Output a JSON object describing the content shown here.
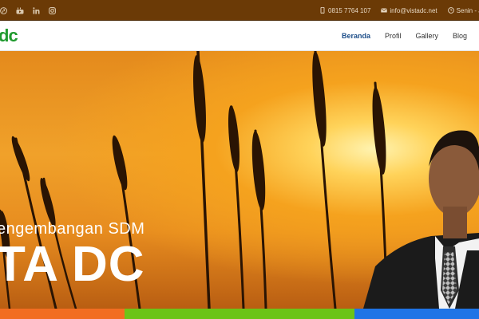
{
  "topbar": {
    "social_icons": [
      "pinterest-icon",
      "youtube-icon",
      "linkedin-icon",
      "instagram-icon"
    ],
    "phone": "0815 7764 107",
    "email": "info@vistadc.net",
    "hours": "Senin - Jus"
  },
  "navbar": {
    "logo": "dc",
    "menu": [
      "Beranda",
      "Profil",
      "Gallery",
      "Blog"
    ],
    "active_index": 0
  },
  "hero": {
    "subtitle": "engembangan SDM",
    "title": "TA DC"
  },
  "colors": {
    "topbar": "#6b3a06",
    "logo": "#1f9a2e",
    "nav_active": "#1e4f8a",
    "strip": [
      "#f26d21",
      "#6cc417",
      "#1f74e6"
    ]
  }
}
